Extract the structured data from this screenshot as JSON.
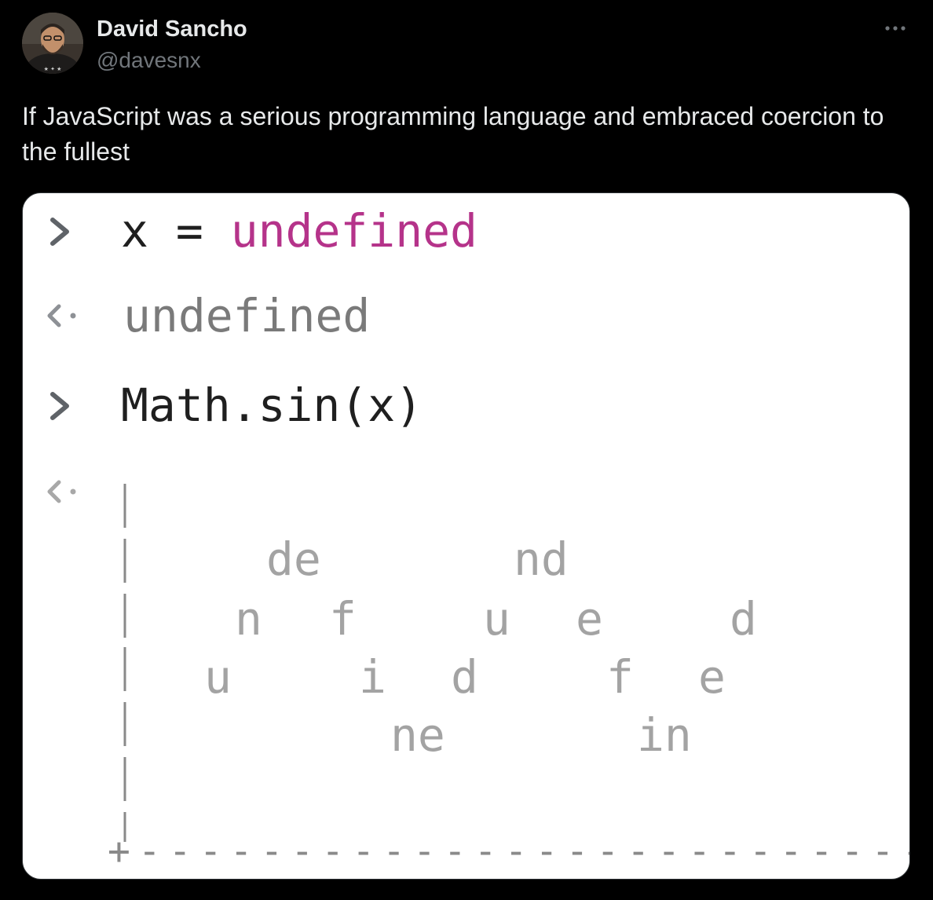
{
  "tweet": {
    "author_name": "David Sancho",
    "author_handle": "@davesnx",
    "text": "If JavaScript was a serious programming language and embraced coercion to the fullest",
    "more_icon": "more-horizontal-icon",
    "avatar_icon": "user-avatar"
  },
  "console": {
    "input_prompt_icon": "chevron-right-icon",
    "output_prompt_icon": "return-arrow-icon",
    "entries": [
      {
        "kind": "input",
        "parts": [
          {
            "text": "x = ",
            "color": "#1f1f1f"
          },
          {
            "text": "undefined",
            "color": "#b5338a"
          }
        ]
      },
      {
        "kind": "output",
        "text": "undefined",
        "color": "#7a7a7a"
      },
      {
        "kind": "input",
        "text": "Math.sin(x)",
        "color": "#1f1f1f"
      },
      {
        "kind": "output",
        "text": "",
        "color": "#7a7a7a"
      }
    ],
    "ascii_plot": {
      "glyph_color": "#a3a3a3",
      "axis_color": "#8a8a8a",
      "rows": [
        [
          "de",
          "nd"
        ],
        [
          "n",
          "f",
          "u",
          "e",
          "d"
        ],
        [
          "u",
          "i",
          "d",
          "f",
          "e"
        ],
        [
          "ne",
          "in"
        ]
      ],
      "x_axis": "+--------------------------"
    }
  },
  "colors": {
    "background": "#000000",
    "primary_text": "#e7e9ea",
    "secondary_text": "#71767b",
    "card_background": "#ffffff",
    "card_border": "#2f3336",
    "prompt_gray": "#5f6368",
    "keyword_magenta": "#b5338a"
  }
}
